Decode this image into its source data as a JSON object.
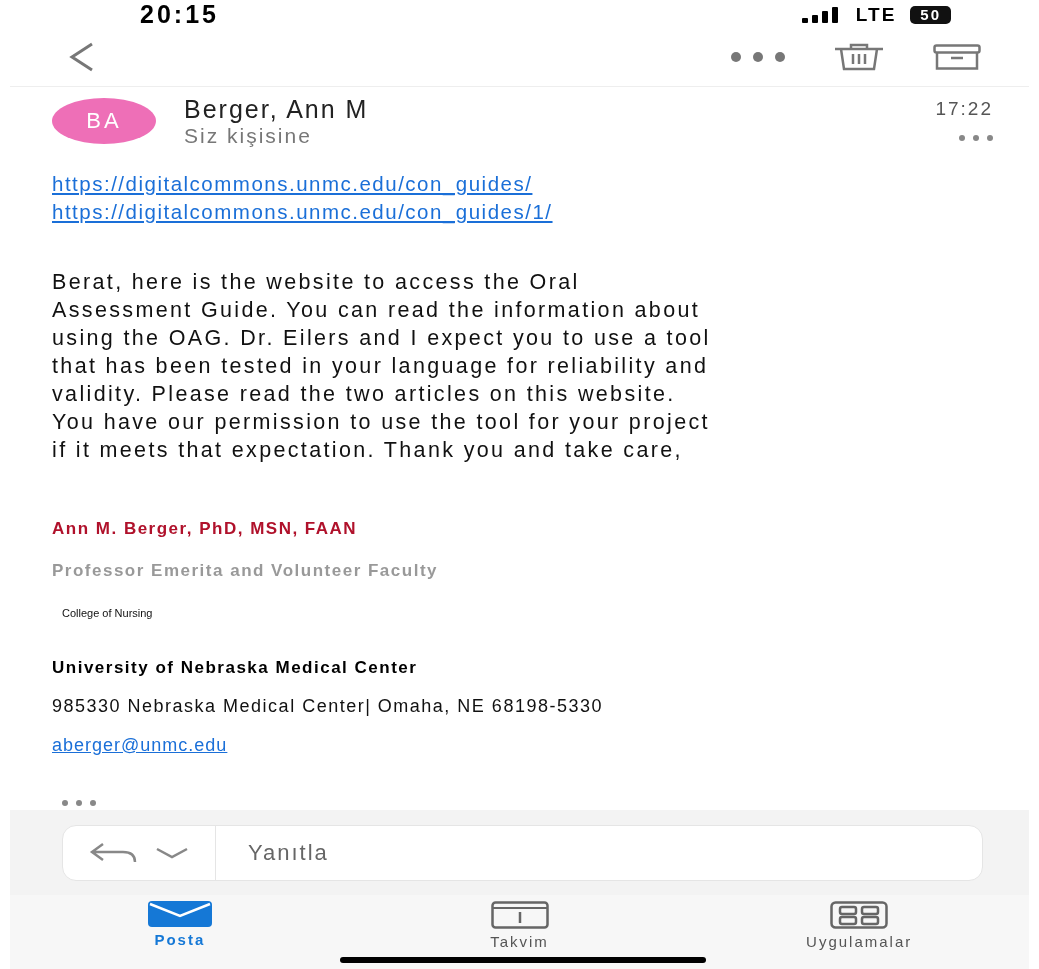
{
  "status_bar": {
    "time": "20:15",
    "network": "LTE",
    "battery": "50"
  },
  "message": {
    "avatar": "BA",
    "sender": "Berger, Ann M",
    "recipient": "Siz kişisine",
    "time": "17:22",
    "links": [
      "https://digitalcommons.unmc.edu/con_guides/",
      "https://digitalcommons.unmc.edu/con_guides/1/"
    ],
    "body": "Berat, here is the website to access the Oral\nAssessment Guide. You can read the information about\nusing the OAG. Dr. Eilers and I expect you to use a tool\nthat has been tested in your language for reliability and\nvalidity. Please read the two articles on this website.\nYou have our permission to use the tool for your project\nif it meets that expectation. Thank you and take care,",
    "signature": [
      {
        "kind": "name",
        "text": "Ann M. Berger, PhD, MSN, FAAN"
      },
      {
        "kind": "title",
        "text": "Professor Emerita and Volunteer Faculty"
      },
      {
        "kind": "small",
        "text": "College of Nursing"
      },
      {
        "kind": "org",
        "text": "University of Nebraska Medical Center"
      },
      {
        "kind": "plain",
        "text": "985330 Nebraska Medical Center| Omaha, NE 68198-5330"
      },
      {
        "kind": "link",
        "text": "aberger@unmc.edu"
      }
    ]
  },
  "reply": {
    "placeholder": "Yanıtla"
  },
  "tabs": [
    {
      "label": "Posta",
      "kind": "mail",
      "selected": true
    },
    {
      "label": "Takvim",
      "kind": "calendar",
      "selected": false
    },
    {
      "label": "Uygulamalar",
      "kind": "apps",
      "selected": false
    }
  ]
}
